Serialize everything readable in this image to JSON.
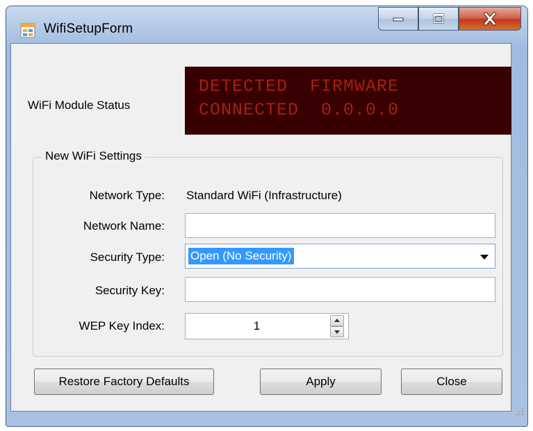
{
  "window": {
    "title": "WifiSetupForm",
    "app_icon": "form-icon",
    "caption_buttons": [
      "minimize-icon",
      "maximize-icon",
      "close-icon"
    ]
  },
  "status": {
    "label": "WiFi Module Status",
    "line1": "DETECTED  FIRMWARE",
    "line2": "CONNECTED  0.0.0.0",
    "display_bg": "#380000",
    "display_fg": "#a3210e"
  },
  "group": {
    "title": "New WiFi Settings"
  },
  "fields": {
    "network_type_label": "Network Type:",
    "network_type_value": "Standard WiFi (Infrastructure)",
    "network_name_label": "Network Name:",
    "network_name_value": "",
    "security_type_label": "Security Type:",
    "security_type_value": "Open (No Security)",
    "security_key_label": "Security Key:",
    "security_key_value": "",
    "wep_index_label": "WEP Key Index:",
    "wep_index_value": "1"
  },
  "buttons": {
    "restore": "Restore Factory Defaults",
    "apply": "Apply",
    "close": "Close"
  }
}
